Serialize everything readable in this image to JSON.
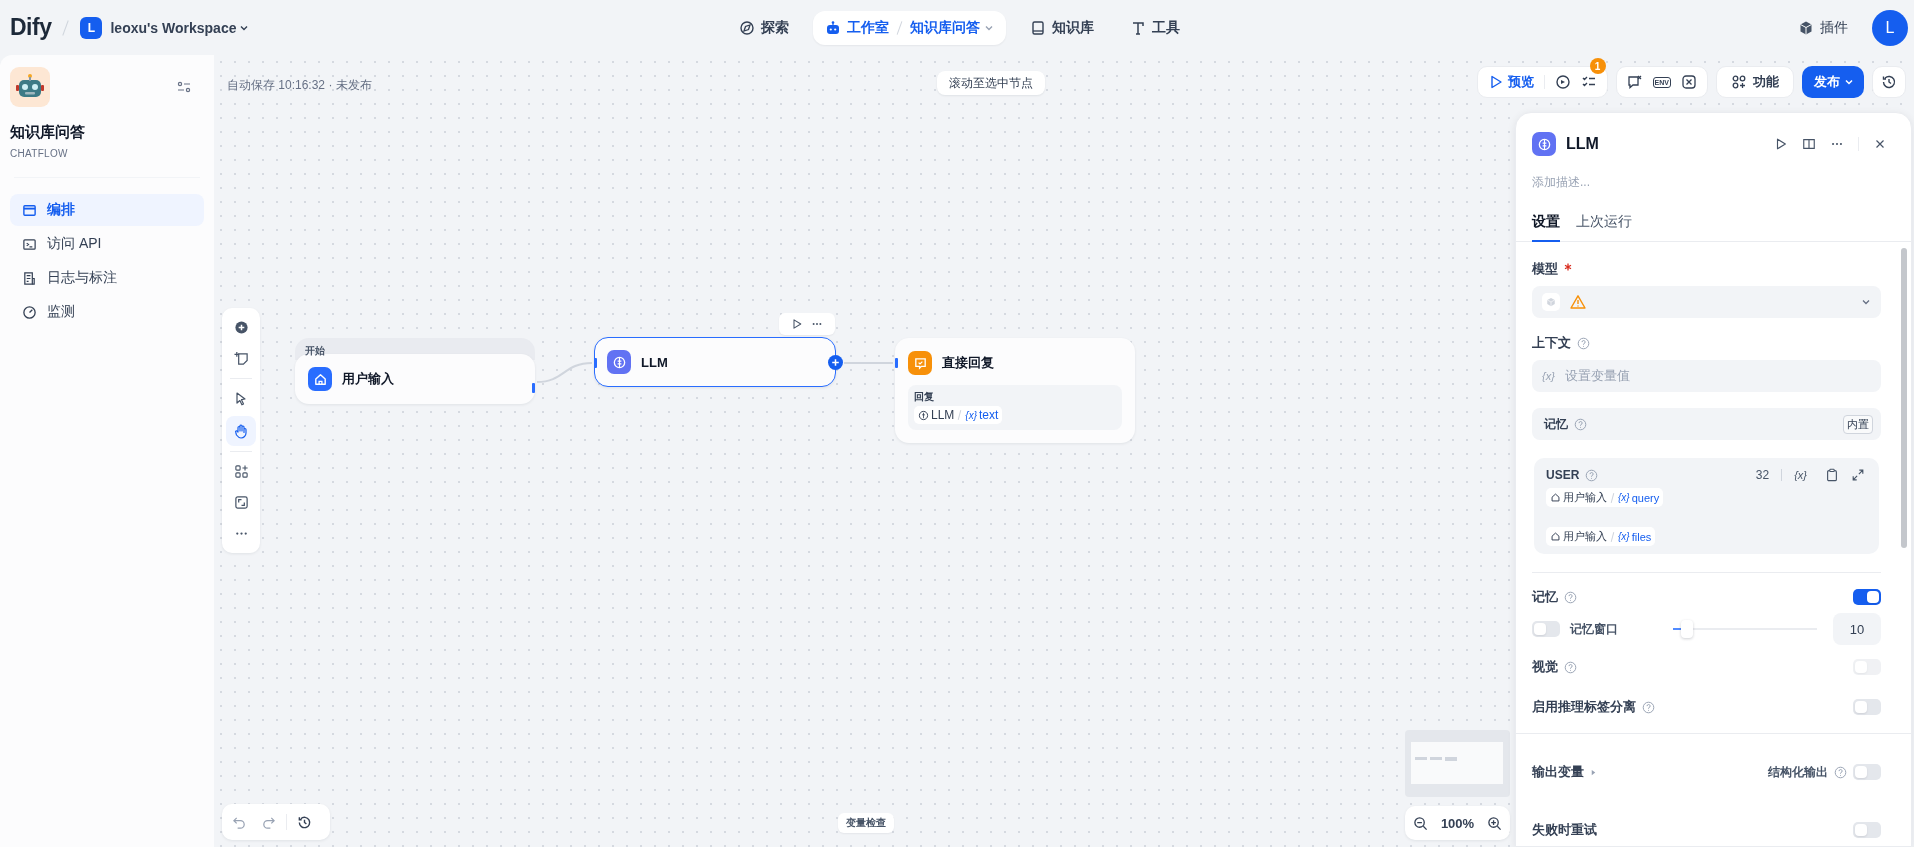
{
  "top_bar": {
    "logo": "Dify",
    "workspace": {
      "avatar": "L",
      "name": "leoxu's Workspace"
    },
    "nav": [
      {
        "label": "探索",
        "selected": false
      },
      {
        "label": "工作室",
        "selected": true,
        "current_app": "知识库问答"
      },
      {
        "label": "知识库",
        "selected": false
      },
      {
        "label": "工具",
        "selected": false
      }
    ],
    "plugins": "插件",
    "user_avatar": "L"
  },
  "sidebar": {
    "app_name": "知识库问答",
    "app_type": "CHATFLOW",
    "items": [
      {
        "label": "编排",
        "selected": true
      },
      {
        "label": "访问 API",
        "selected": false
      },
      {
        "label": "日志与标注",
        "selected": false
      },
      {
        "label": "监测",
        "selected": false
      }
    ]
  },
  "canvas": {
    "autosave": "自动保存 10:16:32 · 未发布",
    "scroll_to_node": "滚动至选中节点",
    "preview": "预览",
    "checklist_badge": "1",
    "env_label": "ENV",
    "features": "功能",
    "publish": "发布",
    "pointer_modes": [
      {
        "selected": false
      },
      {
        "selected": true
      }
    ],
    "nodes": [
      {
        "kind": "start",
        "header": "开始",
        "title": "用户输入",
        "selected": false
      },
      {
        "kind": "llm",
        "title": "LLM",
        "selected": true
      },
      {
        "kind": "answer",
        "title": "直接回复",
        "selected": false,
        "field_label": "回复",
        "ref": {
          "node": "LLM",
          "var_mark": "{x}",
          "var": "text"
        }
      }
    ],
    "variable_inspect": "变量检查",
    "zoom": "100%"
  },
  "panel": {
    "title": "LLM",
    "description_placeholder": "添加描述...",
    "tabs": [
      {
        "label": "设置",
        "selected": true
      },
      {
        "label": "上次运行",
        "selected": false
      }
    ],
    "model": {
      "label": "模型",
      "required": true
    },
    "context": {
      "label": "上下文",
      "var_mark": "{x}",
      "placeholder": "设置变量值"
    },
    "memory_header": {
      "label": "记忆",
      "badge": "内置"
    },
    "user_prompt": {
      "role": "USER",
      "count": "32",
      "var_mark": "{x}",
      "chips": [
        {
          "node": "用户输入",
          "var_mark": "{x}",
          "var": "query"
        },
        {
          "node": "用户输入",
          "var_mark": "{x}",
          "var": "files"
        }
      ]
    },
    "memory": {
      "label": "记忆",
      "on": true,
      "window": {
        "label": "记忆窗口",
        "on": false,
        "level": 0.1,
        "value": "10"
      }
    },
    "vision": {
      "label": "视觉",
      "on": false,
      "disabled": true
    },
    "reasoning_split": {
      "label": "启用推理标签分离",
      "on": false
    },
    "output": {
      "label": "输出变量",
      "structured_label": "结构化输出",
      "structured_on": false
    },
    "retry": {
      "label": "失败时重试",
      "on": false
    }
  }
}
